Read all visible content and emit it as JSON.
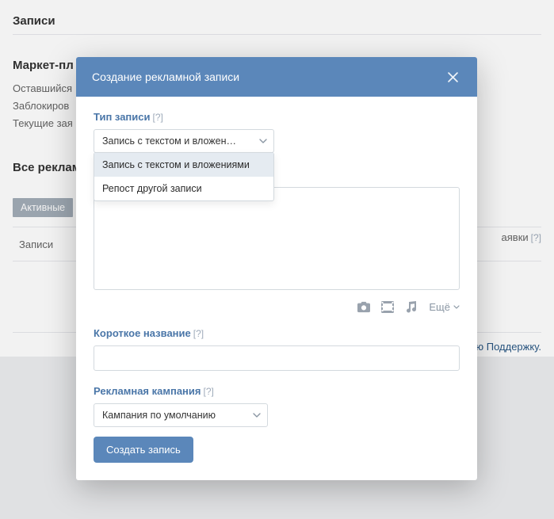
{
  "page": {
    "header1": "Записи",
    "header2": "Маркет-пл",
    "muted1": "Оставшийся",
    "muted2": "Заблокиров",
    "muted3": "Текущие зая",
    "header3": "Все реклам",
    "tab_active": "Активные",
    "table_col1": "Записи",
    "right_col": "аявки",
    "support": "ю Поддержку."
  },
  "modal": {
    "title": "Создание рекламной записи",
    "type_label": "Тип записи",
    "help": "[?]",
    "type_select": {
      "value": "Запись с текстом и вложен…",
      "options": [
        "Запись с текстом и вложениями",
        "Репост другой записи"
      ]
    },
    "short_name_label": "Короткое название",
    "short_name_value": "",
    "campaign_label": "Рекламная кампания",
    "campaign_select": {
      "value": "Кампания по умолчанию"
    },
    "attach_more": "Ещё",
    "submit": "Создать запись"
  }
}
